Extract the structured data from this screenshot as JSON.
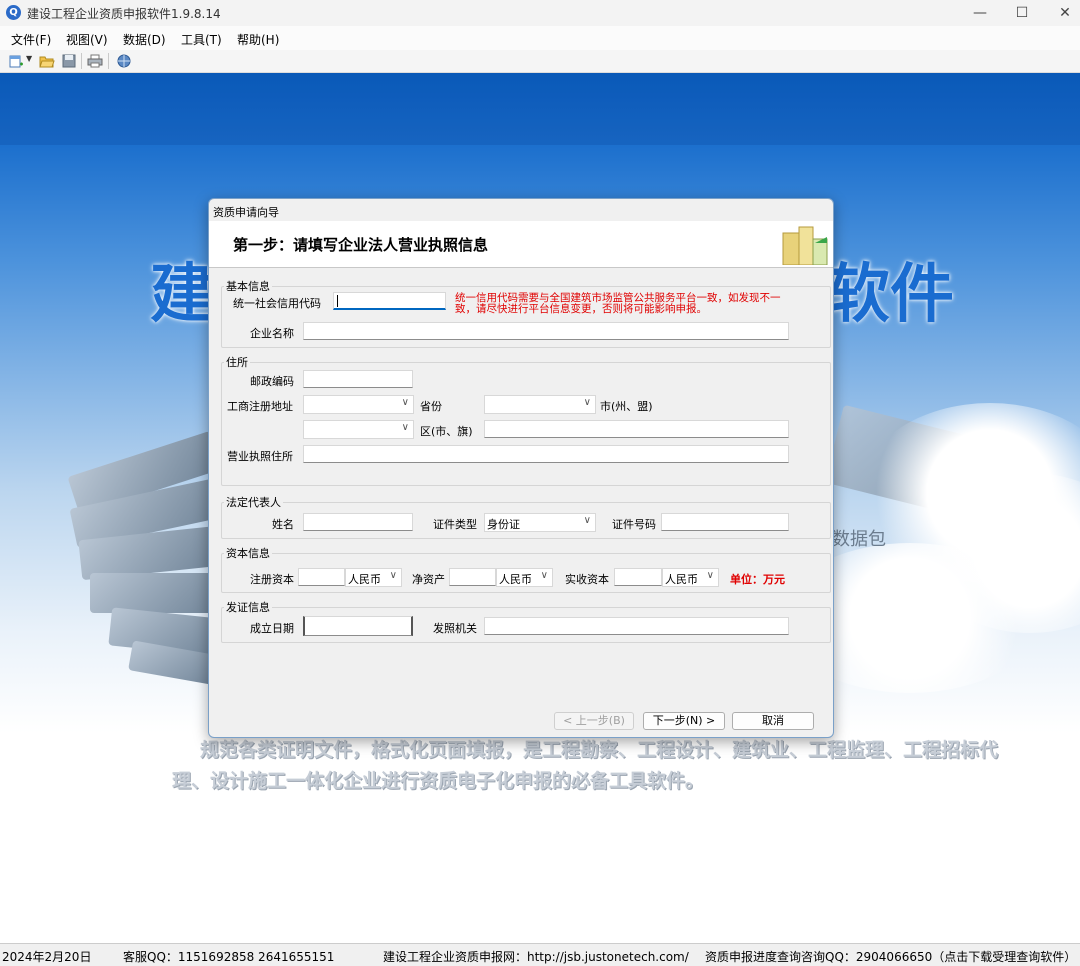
{
  "window": {
    "title": "建设工程企业资质申报软件1.9.8.14",
    "app_icon": "Q",
    "controls": {
      "minimize": "—",
      "maximize": "☐",
      "close": "✕"
    }
  },
  "menu": [
    "文件(F)",
    "视图(V)",
    "数据(D)",
    "工具(T)",
    "帮助(H)"
  ],
  "toolbar_icons": [
    "new-icon",
    "open-folder-icon",
    "save-icon",
    "print-icon",
    "globe-refresh-icon"
  ],
  "background": {
    "title_left": "建",
    "title_right": "软件",
    "pack_text": "数据包",
    "slogan": "规范各类证明文件，格式化页面填报，是工程勘察、工程设计、建筑业、工程监理、工程招标代理、设计施工一体化企业进行资质电子化申报的必备工具软件。"
  },
  "dialog": {
    "title": "资质申请向导",
    "step": "第一步：请填写企业法人营业执照信息",
    "basic": {
      "legend": "基本信息",
      "credit_code_label": "统一社会信用代码",
      "credit_code_value": "",
      "warning": "统一信用代码需要与全国建筑市场监管公共服务平台一致，如发现不一致，请尽快进行平台信息变更，否则将可能影响申报。",
      "company_label": "企业名称",
      "company_value": ""
    },
    "address": {
      "legend": "住所",
      "postcode_label": "邮政编码",
      "reg_address_label": "工商注册地址",
      "province_label": "省份",
      "city_label": "市(州、盟)",
      "district_label": "区(市、旗)",
      "license_address_label": "营业执照住所"
    },
    "legal_rep": {
      "legend": "法定代表人",
      "name_label": "姓名",
      "id_type_label": "证件类型",
      "id_type_value": "身份证",
      "id_no_label": "证件号码"
    },
    "capital": {
      "legend": "资本信息",
      "registered_label": "注册资本",
      "registered_currency": "人民币",
      "net_assets_label": "净资产",
      "net_assets_currency": "人民币",
      "paid_in_label": "实收资本",
      "paid_in_currency": "人民币",
      "unit": "单位：万元"
    },
    "license": {
      "legend": "发证信息",
      "established_label": "成立日期",
      "authority_label": "发照机关"
    },
    "buttons": {
      "prev": "< 上一步(B)",
      "next": "下一步(N) >",
      "cancel": "取消"
    }
  },
  "status": {
    "date": "2024年2月20日",
    "service_qq": "客服QQ：1151692858   2641655151",
    "website": "建设工程企业资质申报网：http://jsb.justonetech.com/",
    "progress_qq": "资质申报进度查询咨询QQ：2904066650（点击下载受理查询软件）"
  },
  "colors": {
    "accent": "#0067c0",
    "warning": "#e00000",
    "background_blue": "#1b6fcd"
  }
}
